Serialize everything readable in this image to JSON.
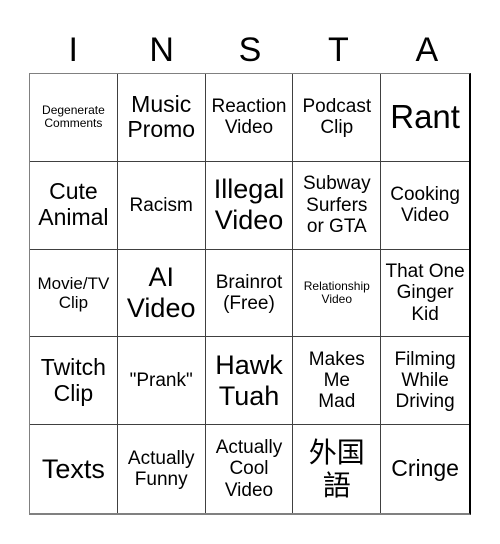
{
  "header": {
    "letters": [
      "I",
      "N",
      "S",
      "T",
      "A"
    ]
  },
  "grid": {
    "rows": [
      [
        "Degenerate\nComments",
        "Music\nPromo",
        "Reaction\nVideo",
        "Podcast\nClip",
        "Rant"
      ],
      [
        "Cute\nAnimal",
        "Racism",
        "Illegal\nVideo",
        "Subway\nSurfers\nor GTA",
        "Cooking\nVideo"
      ],
      [
        "Movie/TV\nClip",
        "AI\nVideo",
        "Brainrot\n(Free)",
        "Relationship\nVideo",
        "That One\nGinger\nKid"
      ],
      [
        "Twitch\nClip",
        "\"Prank\"",
        "Hawk\nTuah",
        "Makes\nMe\nMad",
        "Filming\nWhile\nDriving"
      ],
      [
        "Texts",
        "Actually\nFunny",
        "Actually\nCool\nVideo",
        "外国\n語",
        "Cringe"
      ]
    ]
  }
}
